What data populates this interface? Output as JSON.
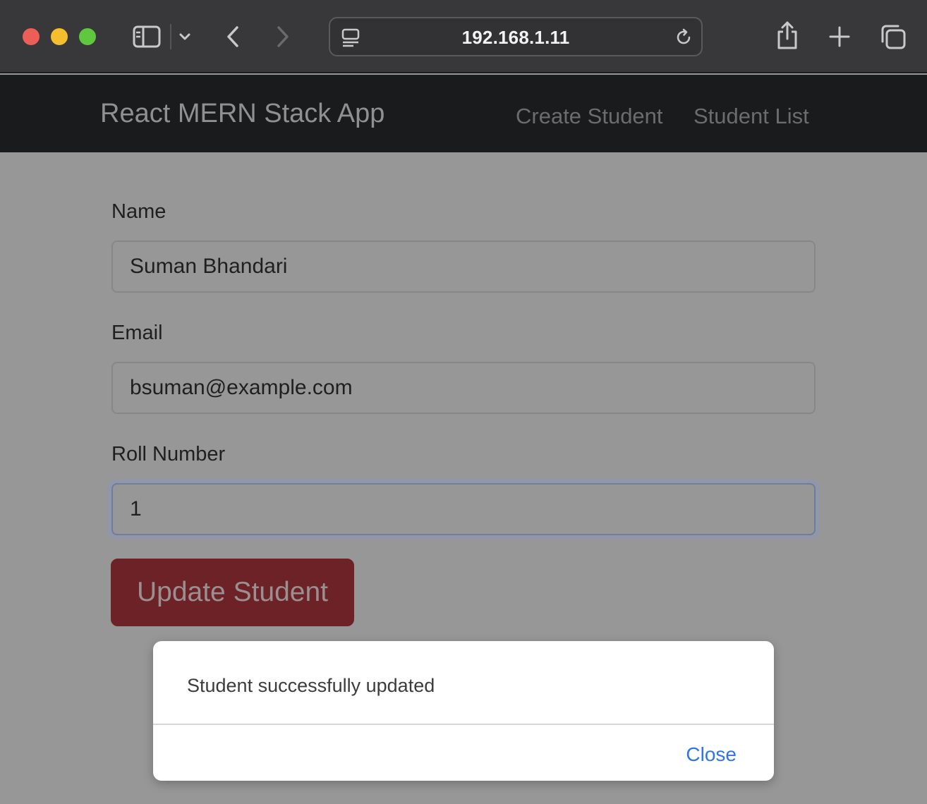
{
  "browser": {
    "address": "192.168.1.11",
    "icons": [
      "sidebar-icon",
      "chevron-down-icon",
      "back-arrow-icon",
      "forward-arrow-icon",
      "page-menu-icon",
      "reload-icon",
      "share-icon",
      "new-tab-icon",
      "tabs-overview-icon"
    ]
  },
  "navbar": {
    "brand": "React MERN Stack App",
    "links": [
      "Create Student",
      "Student List"
    ]
  },
  "form": {
    "name_label": "Name",
    "name_value": "Suman Bhandari",
    "email_label": "Email",
    "email_value": "bsuman@example.com",
    "roll_label": "Roll Number",
    "roll_value": "1",
    "submit_label": "Update Student"
  },
  "modal": {
    "message": "Student successfully updated",
    "close_label": "Close"
  },
  "colors": {
    "overlay_bg": "#979797",
    "navbar_bg": "#1a1b1d",
    "button_bg": "#6d2227",
    "close_link": "#2f75e6"
  }
}
